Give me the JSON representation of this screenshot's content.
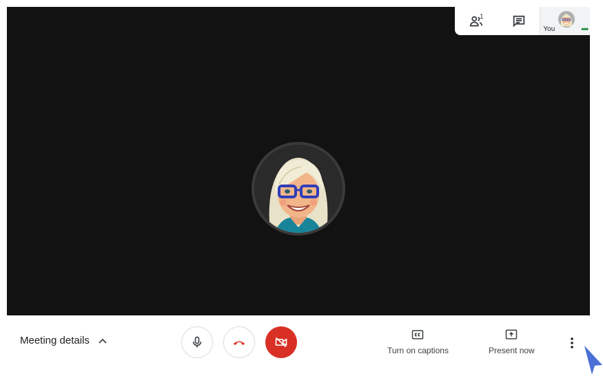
{
  "topbar": {
    "people_count": "1",
    "self_label": "You",
    "self_dots": "•••"
  },
  "bottombar": {
    "meeting_details_label": "Meeting details",
    "captions_label": "Turn on captions",
    "present_label": "Present now"
  },
  "icons": {
    "people": "people-icon",
    "chat": "chat-icon",
    "chevron": "chevron-up-icon",
    "mic": "microphone-icon",
    "hangup": "phone-hangup-icon",
    "camera_off": "camera-off-icon",
    "captions": "closed-captions-icon",
    "present": "present-screen-icon",
    "more": "more-vert-icon"
  },
  "colors": {
    "stage_bg": "#121212",
    "red": "#d93025",
    "green": "#1e8e3e",
    "cursor": "#4a6fd6"
  }
}
